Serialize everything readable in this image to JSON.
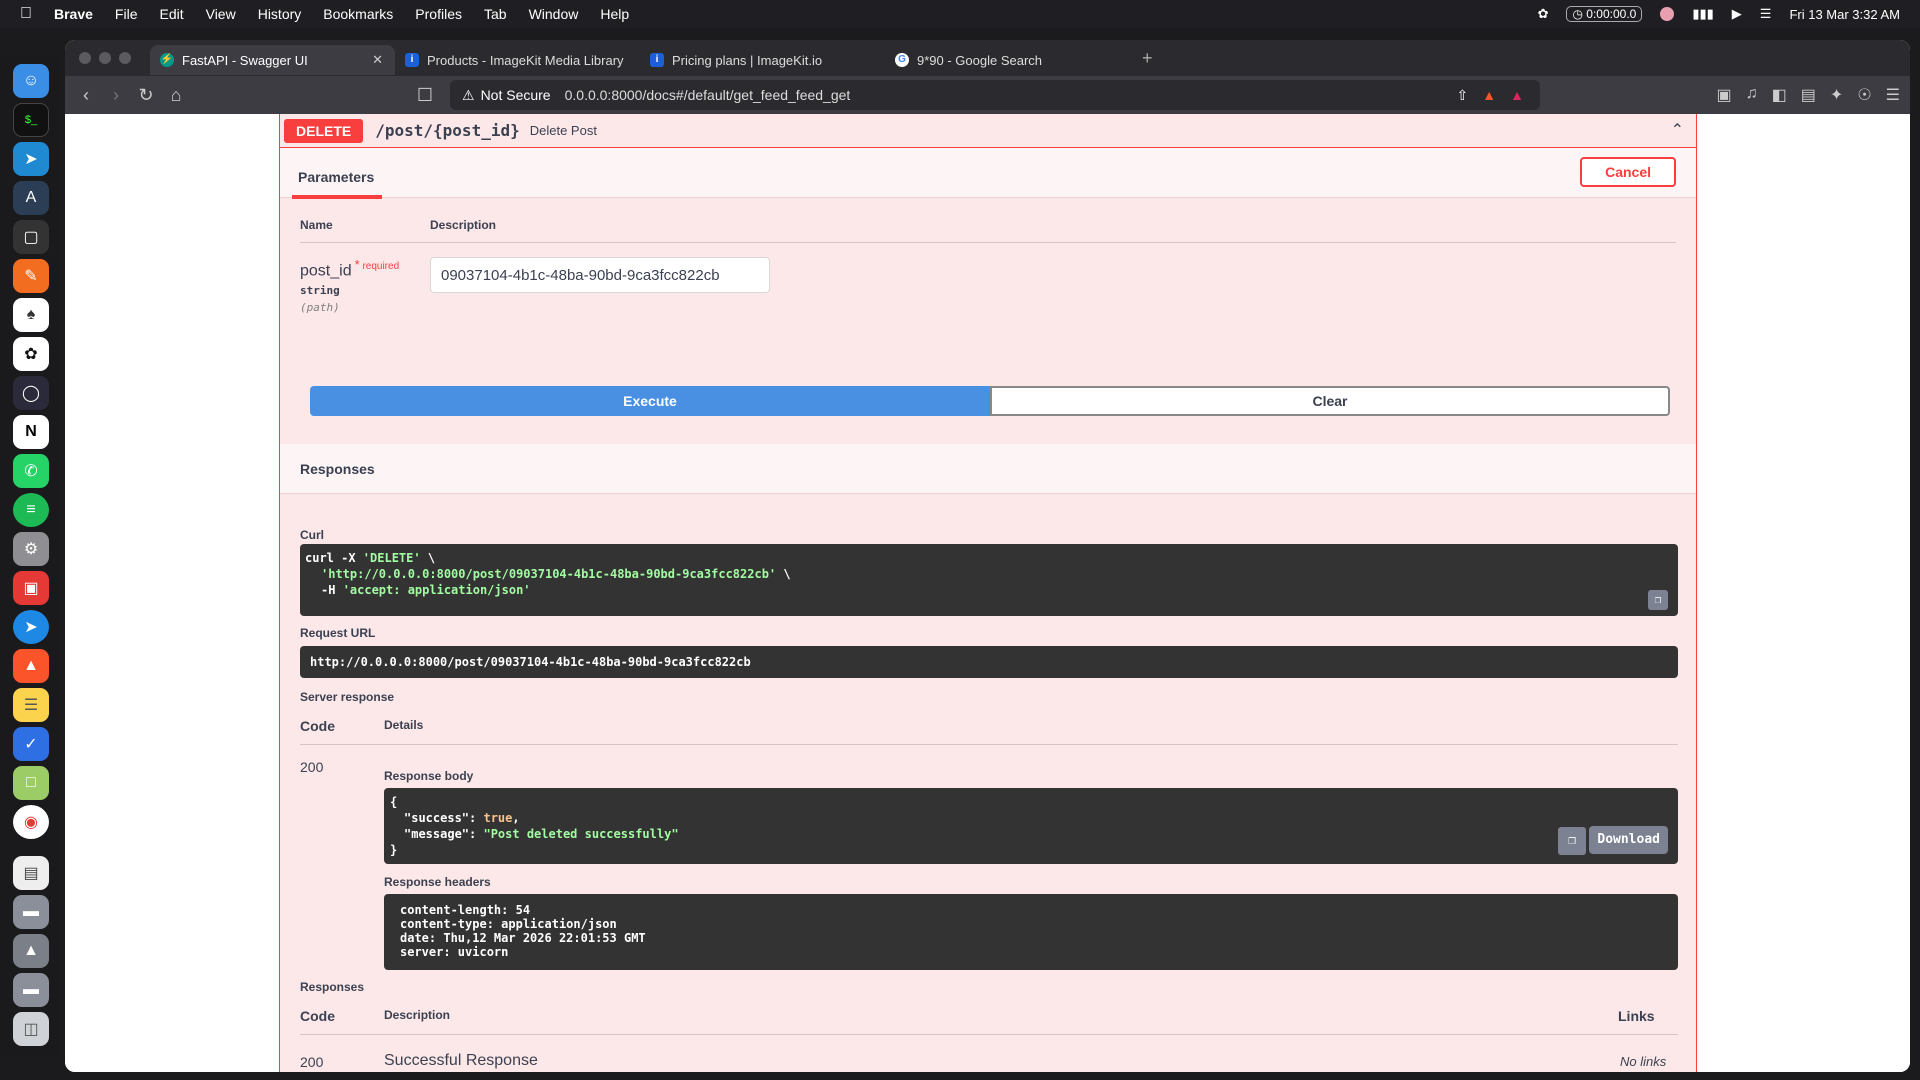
{
  "menubar": {
    "app": "Brave",
    "items": [
      "File",
      "Edit",
      "View",
      "History",
      "Bookmarks",
      "Profiles",
      "Tab",
      "Window",
      "Help"
    ],
    "record_time": "0:00:00.0",
    "datetime": "Fri 13 Mar  3:32 AM"
  },
  "tabs": [
    {
      "title": "FastAPI - Swagger UI",
      "active": true
    },
    {
      "title": "Products - ImageKit Media Library",
      "active": false
    },
    {
      "title": "Pricing plans | ImageKit.io",
      "active": false
    },
    {
      "title": "9*90 - Google Search",
      "active": false
    }
  ],
  "address": {
    "security": "Not Secure",
    "url": "0.0.0.0:8000/docs#/default/get_feed_feed_get"
  },
  "operation": {
    "method": "DELETE",
    "path": "/post/{post_id}",
    "summary": "Delete Post"
  },
  "parameters": {
    "tab_label": "Parameters",
    "cancel_label": "Cancel",
    "col_name": "Name",
    "col_description": "Description",
    "param": {
      "name": "post_id",
      "required_marker": "*",
      "required_label": "required",
      "type": "string",
      "in": "(path)",
      "value": "09037104-4b1c-48ba-90bd-9ca3fcc822cb"
    }
  },
  "actions": {
    "execute": "Execute",
    "clear": "Clear"
  },
  "responses": {
    "title": "Responses",
    "curl_label": "Curl",
    "curl_line1_a": "curl -X ",
    "curl_line1_b": "'DELETE'",
    "curl_line1_c": " \\",
    "curl_line2_a": "'http://0.0.0.0:8000/post/09037104-4b1c-48ba-90bd-9ca3fcc822cb'",
    "curl_line2_b": " \\",
    "curl_line3_a": "-H ",
    "curl_line3_b": "'accept: application/json'",
    "request_url_label": "Request URL",
    "request_url": "http://0.0.0.0:8000/post/09037104-4b1c-48ba-90bd-9ca3fcc822cb",
    "server_response_label": "Server response",
    "col_code": "Code",
    "col_details": "Details",
    "code": "200",
    "body_label": "Response body",
    "body_open": "{",
    "body_key1": "\"success\"",
    "body_val1": "true",
    "body_key2": "\"message\"",
    "body_val2": "\"Post deleted successfully\"",
    "body_close": "}",
    "download_label": "Download",
    "headers_label": "Response headers",
    "headers": [
      "content-length: 54",
      "content-type: application/json",
      "date: Thu,12 Mar 2026 22:01:53 GMT",
      "server: uvicorn"
    ],
    "doc_title": "Responses",
    "doc_col_code": "Code",
    "doc_col_description": "Description",
    "doc_col_links": "Links",
    "doc_code": "200",
    "doc_description": "Successful Response",
    "doc_links": "No links"
  }
}
